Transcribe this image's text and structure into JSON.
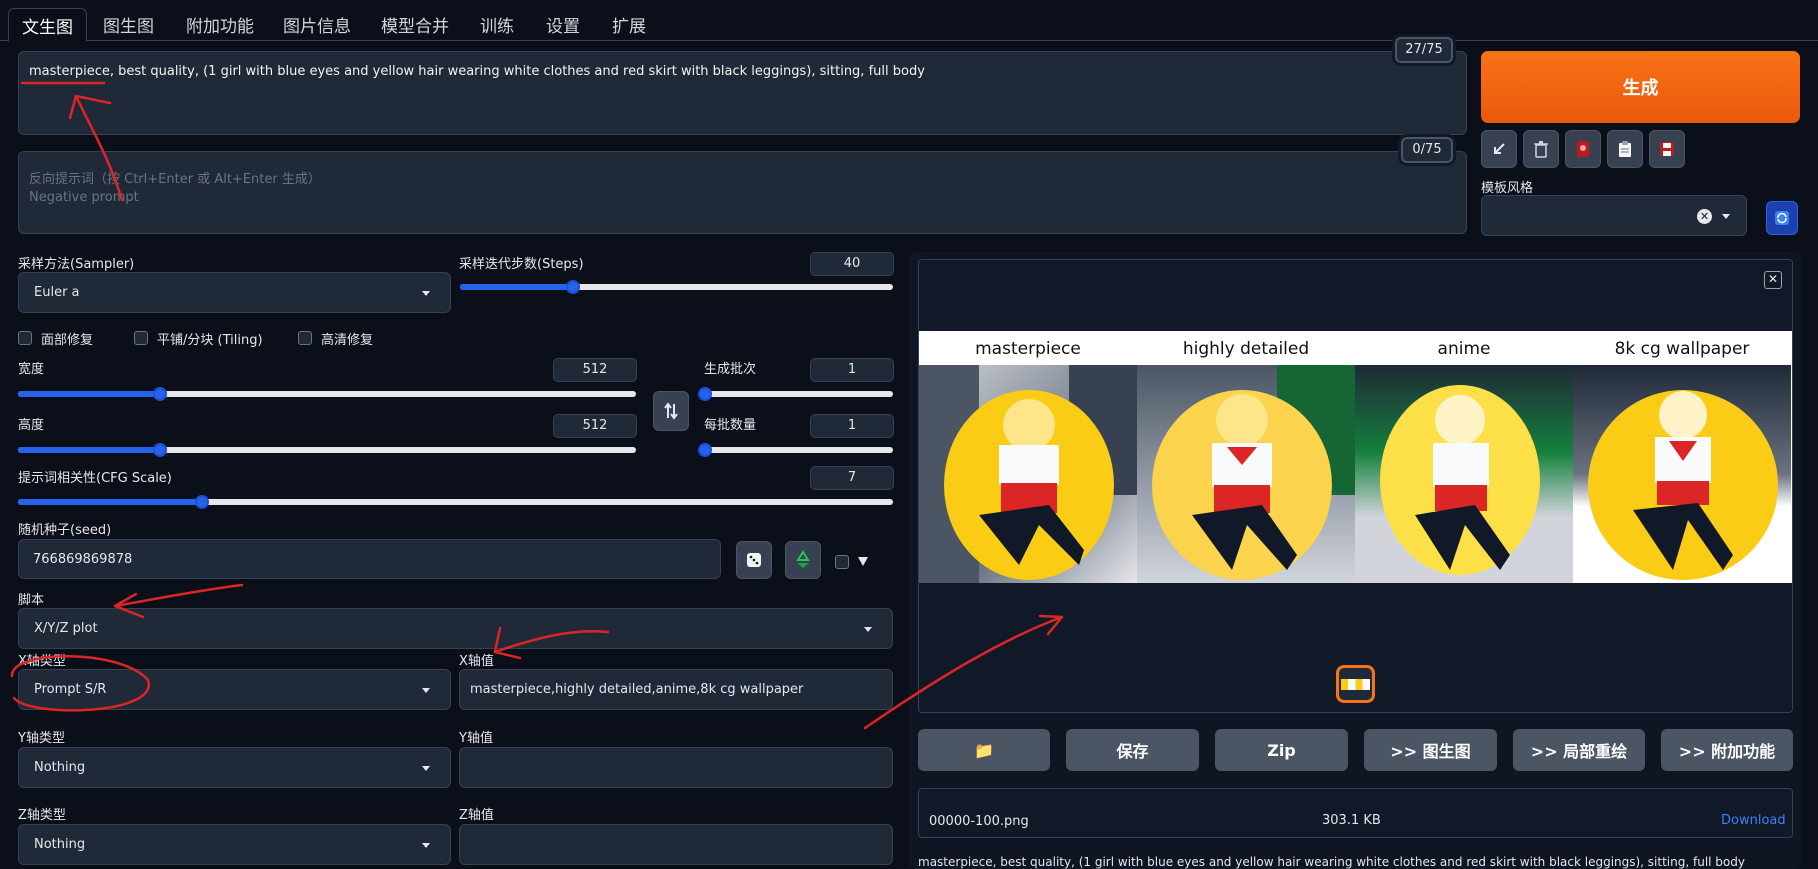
{
  "tabs": [
    "文生图",
    "图生图",
    "附加功能",
    "图片信息",
    "模型合并",
    "训练",
    "设置",
    "扩展"
  ],
  "prompt": {
    "value": "masterpiece, best quality, (1 girl with blue eyes and yellow hair wearing white clothes and red skirt with black leggings), sitting, full body",
    "counter": "27/75"
  },
  "negative_prompt": {
    "placeholder_line1": "反向提示词（按 Ctrl+Enter 或 Alt+Enter 生成）",
    "placeholder_line2": "Negative prompt",
    "counter": "0/75"
  },
  "generate_label": "生成",
  "tool_icons": [
    "arrow-icon",
    "trash-icon",
    "card-icon",
    "clipboard-icon",
    "save-icon"
  ],
  "style": {
    "label": "模板风格",
    "value": ""
  },
  "sampler": {
    "label": "采样方法(Sampler)",
    "value": "Euler a"
  },
  "steps": {
    "label": "采样迭代步数(Steps)",
    "value": "40",
    "fraction": 0.26
  },
  "checkboxes": {
    "face_restore": "面部修复",
    "tiling": "平铺/分块 (Tiling)",
    "hires_fix": "高清修复"
  },
  "width": {
    "label": "宽度",
    "value": "512",
    "fraction": 0.23
  },
  "height": {
    "label": "高度",
    "value": "512",
    "fraction": 0.23
  },
  "batch_count": {
    "label": "生成批次",
    "value": "1",
    "fraction": 0.0
  },
  "batch_size": {
    "label": "每批数量",
    "value": "1",
    "fraction": 0.0
  },
  "cfg": {
    "label": "提示词相关性(CFG Scale)",
    "value": "7",
    "fraction": 0.21
  },
  "seed": {
    "label": "随机种子(seed)",
    "value": "766869869878"
  },
  "script": {
    "label": "脚本",
    "value": "X/Y/Z plot"
  },
  "x_type": {
    "label": "X轴类型",
    "value": "Prompt S/R"
  },
  "x_values": {
    "label": "X轴值",
    "value": "masterpiece,highly detailed,anime,8k cg wallpaper"
  },
  "y_type": {
    "label": "Y轴类型",
    "value": "Nothing"
  },
  "y_values": {
    "label": "Y轴值",
    "value": ""
  },
  "z_type": {
    "label": "Z轴类型",
    "value": "Nothing"
  },
  "z_values": {
    "label": "Z轴值",
    "value": ""
  },
  "grid_titles": [
    "masterpiece",
    "highly detailed",
    "anime",
    "8k cg wallpaper"
  ],
  "actions": {
    "folder": "📁",
    "save": "保存",
    "zip": "Zip",
    "img2img": ">> 图生图",
    "inpaint": ">> 局部重绘",
    "extras": ">> 附加功能"
  },
  "file": {
    "name": "00000-100.png",
    "size": "303.1 KB",
    "download": "Download"
  },
  "info_text": "masterpiece, best quality, (1 girl with blue eyes and yellow hair wearing white clothes and red skirt with black leggings), sitting, full body",
  "colors": {
    "accent": "#f97316",
    "slider": "#2563eb",
    "annotation": "#dc2626"
  }
}
